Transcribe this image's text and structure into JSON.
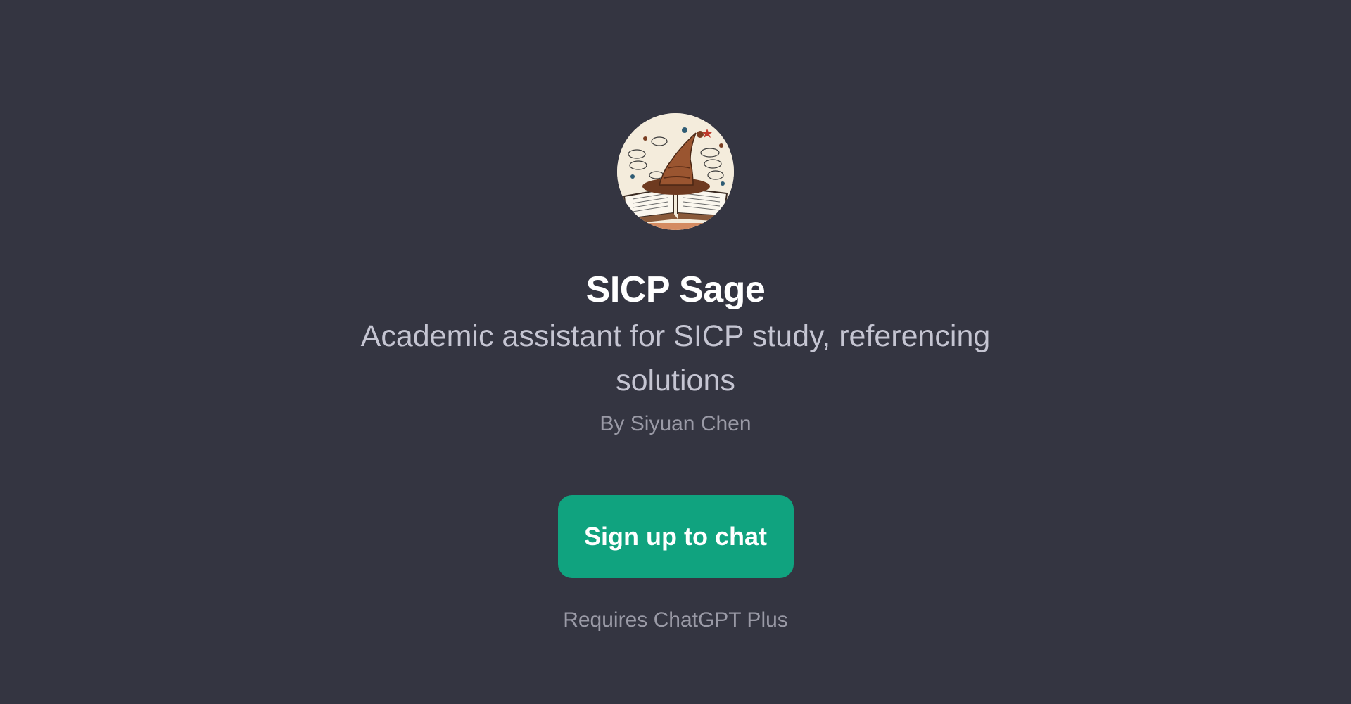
{
  "gpt": {
    "name": "SICP Sage",
    "description": "Academic assistant for SICP study, referencing solutions",
    "author": "By Siyuan Chen",
    "avatar_icon": "wizard-hat-on-open-book"
  },
  "actions": {
    "signup_label": "Sign up to chat",
    "requirement_note": "Requires ChatGPT Plus"
  },
  "colors": {
    "background": "#343541",
    "accent": "#10a37f",
    "title": "#ffffff",
    "description": "#c5c5d2",
    "muted": "#9a9aa6"
  }
}
